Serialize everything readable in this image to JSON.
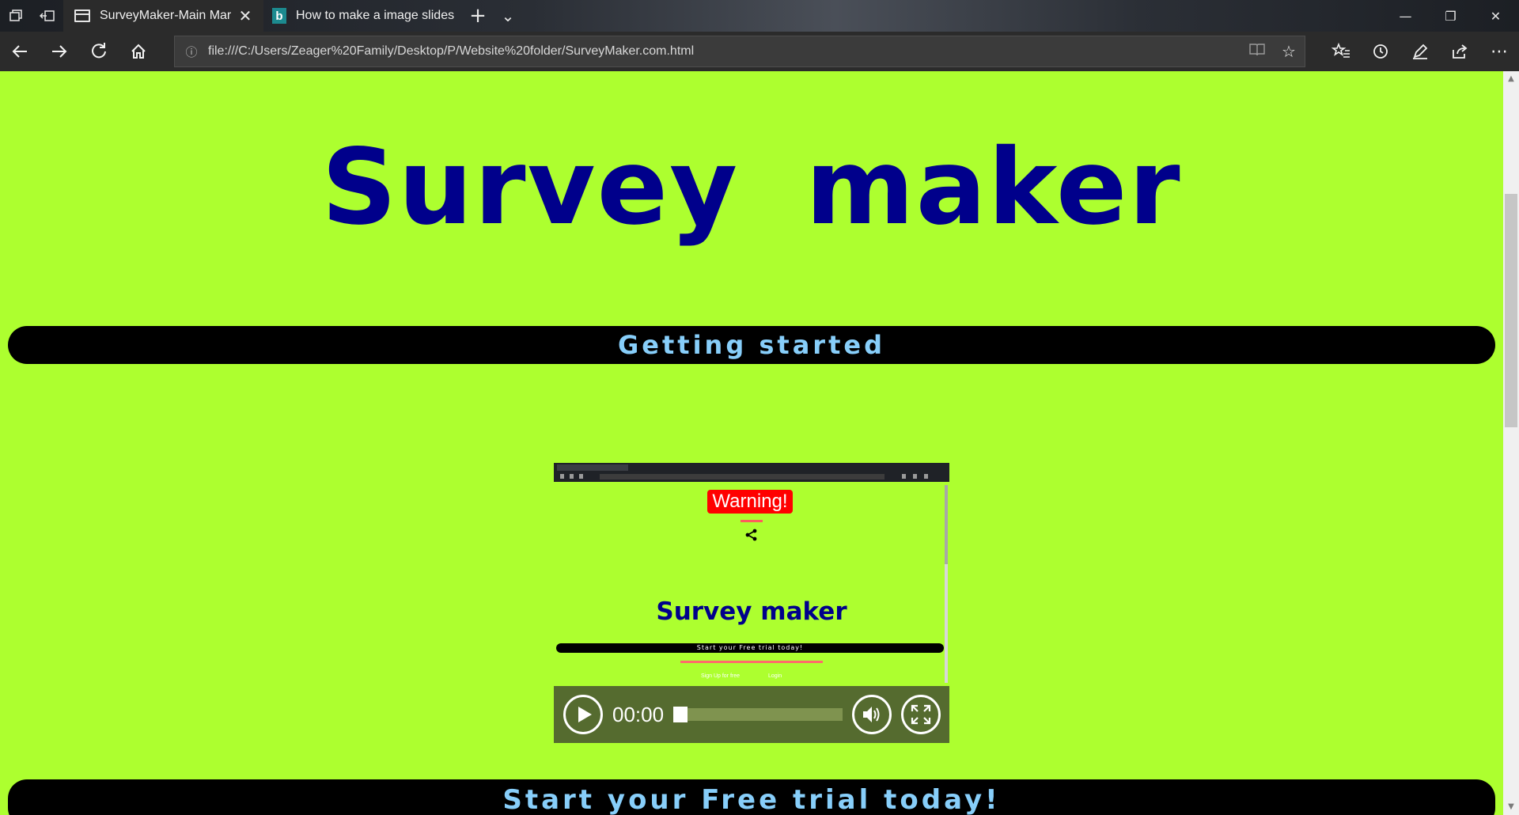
{
  "browser": {
    "tabs": [
      {
        "title": "SurveyMaker-Main Mar",
        "active": true
      },
      {
        "title": "How to make a image slides",
        "active": false
      }
    ],
    "new_tab_symbol": "+",
    "tab_list_symbol": "⌄",
    "close_tab_symbol": "✕",
    "window_controls": {
      "minimize": "—",
      "restore": "❐",
      "close": "✕"
    },
    "address": "file:///C:/Users/Zeager%20Family/Desktop/P/Website%20folder/SurveyMaker.com.html",
    "nav_icons": [
      "back-arrow-icon",
      "forward-arrow-icon",
      "refresh-icon",
      "home-icon"
    ],
    "toolbar_icons": [
      "reading-view-icon",
      "favorite-star-icon",
      "favorites-list-icon",
      "history-icon",
      "pen-icon",
      "share-icon",
      "more-icon"
    ]
  },
  "page": {
    "title": "Survey maker",
    "banner_1": "Getting started",
    "banner_2": "Start your Free trial today!",
    "background_color": "#adff2f",
    "title_color": "#00008b",
    "banner_text_color": "#87cefa"
  },
  "video": {
    "time": "00:00",
    "progress": 0,
    "preview": {
      "warning": "Warning!",
      "title": "Survey maker",
      "banner": "Start your Free trial today!",
      "links": [
        "Sign Up for free",
        "Login"
      ]
    },
    "controls_color": "#556b2f"
  }
}
